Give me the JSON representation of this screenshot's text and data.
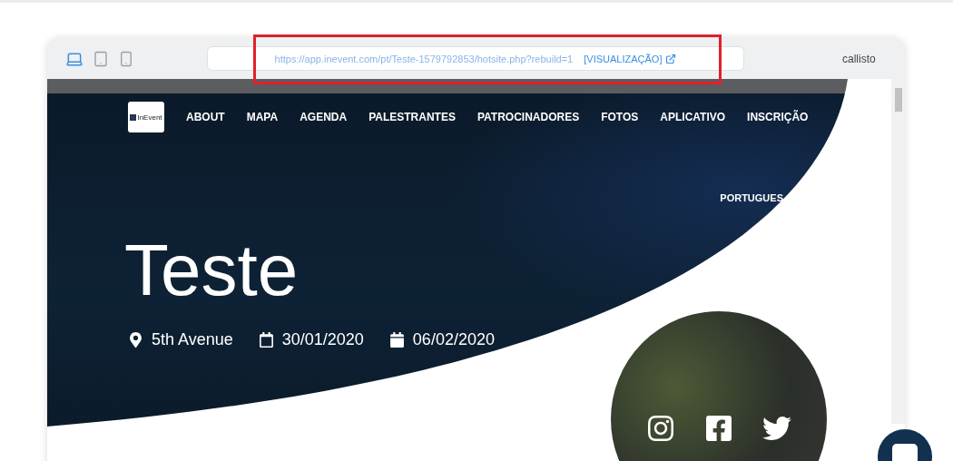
{
  "preview_toolbar": {
    "devices": [
      {
        "kind": "desktop",
        "selected": true
      },
      {
        "kind": "tablet",
        "selected": false
      },
      {
        "kind": "phone",
        "selected": false
      }
    ],
    "url": "https://app.inevent.com/pt/Teste-1579792853/hotsite.php?rebuild=1",
    "preview_link": "[VISUALIZAÇÃO]",
    "theme_name": "callisto",
    "highlighted": true
  },
  "site": {
    "logo_text": "InEvent",
    "nav": {
      "items": [
        "ABOUT",
        "MAPA",
        "AGENDA",
        "PALESTRANTES",
        "PATROCINADORES",
        "FOTOS",
        "APLICATIVO",
        "INSCRIÇÃO"
      ]
    },
    "language": "PORTUGUES",
    "title": "Teste",
    "details": [
      {
        "kind": "location",
        "text": "5th Avenue"
      },
      {
        "kind": "start_date",
        "text": "30/01/2020"
      },
      {
        "kind": "end_date",
        "text": "06/02/2020"
      }
    ],
    "social": [
      {
        "kind": "instagram"
      },
      {
        "kind": "facebook"
      },
      {
        "kind": "twitter"
      }
    ]
  }
}
